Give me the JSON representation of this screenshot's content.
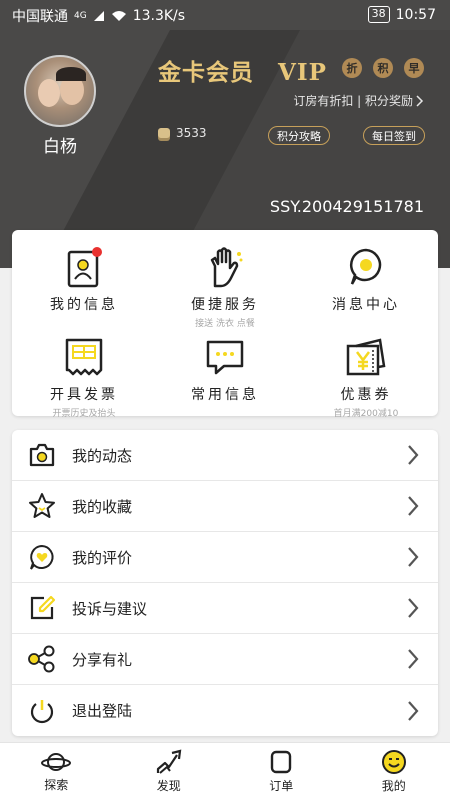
{
  "status_bar": {
    "carrier": "中国联通",
    "net_badge": "4G",
    "speed": "13.3K/s",
    "battery": "38",
    "time": "10:57"
  },
  "profile": {
    "username": "白杨",
    "vip_title": "金卡会员　VIP",
    "vip_badges": [
      "折",
      "积",
      "早"
    ],
    "vip_sub": "订房有折扣 | 积分奖励",
    "points": "3533",
    "points_guide_label": "积分攻略",
    "daily_signin_label": "每日签到",
    "member_no": "SSY.200429151781"
  },
  "grid": {
    "items": [
      {
        "label": "我的信息",
        "sub": "",
        "icon": "profile-card-icon"
      },
      {
        "label": "便捷服务",
        "sub": "接送 洗衣 点餐",
        "icon": "hand-icon"
      },
      {
        "label": "消息中心",
        "sub": "",
        "icon": "message-bubble-icon"
      },
      {
        "label": "开具发票",
        "sub": "开票历史及抬头",
        "icon": "receipt-icon"
      },
      {
        "label": "常用信息",
        "sub": "",
        "icon": "chat-dots-icon"
      },
      {
        "label": "优惠券",
        "sub": "首月满200减10",
        "icon": "coupon-icon"
      }
    ]
  },
  "menu": {
    "items": [
      {
        "label": "我的动态",
        "icon": "camera-icon"
      },
      {
        "label": "我的收藏",
        "icon": "star-icon"
      },
      {
        "label": "我的评价",
        "icon": "heart-chat-icon"
      },
      {
        "label": "投诉与建议",
        "icon": "edit-icon"
      },
      {
        "label": "分享有礼",
        "icon": "share-icon"
      },
      {
        "label": "退出登陆",
        "icon": "power-icon"
      }
    ]
  },
  "bottom_nav": {
    "items": [
      {
        "label": "探索",
        "icon": "planet-icon"
      },
      {
        "label": "发现",
        "icon": "trend-icon"
      },
      {
        "label": "订单",
        "icon": "order-icon"
      },
      {
        "label": "我的",
        "icon": "smile-icon",
        "active": true
      }
    ]
  },
  "colors": {
    "header_bg": "#4a4948",
    "gold": "#e8c77a",
    "accent_yellow": "#f5d820",
    "notification_red": "#e8312f"
  }
}
